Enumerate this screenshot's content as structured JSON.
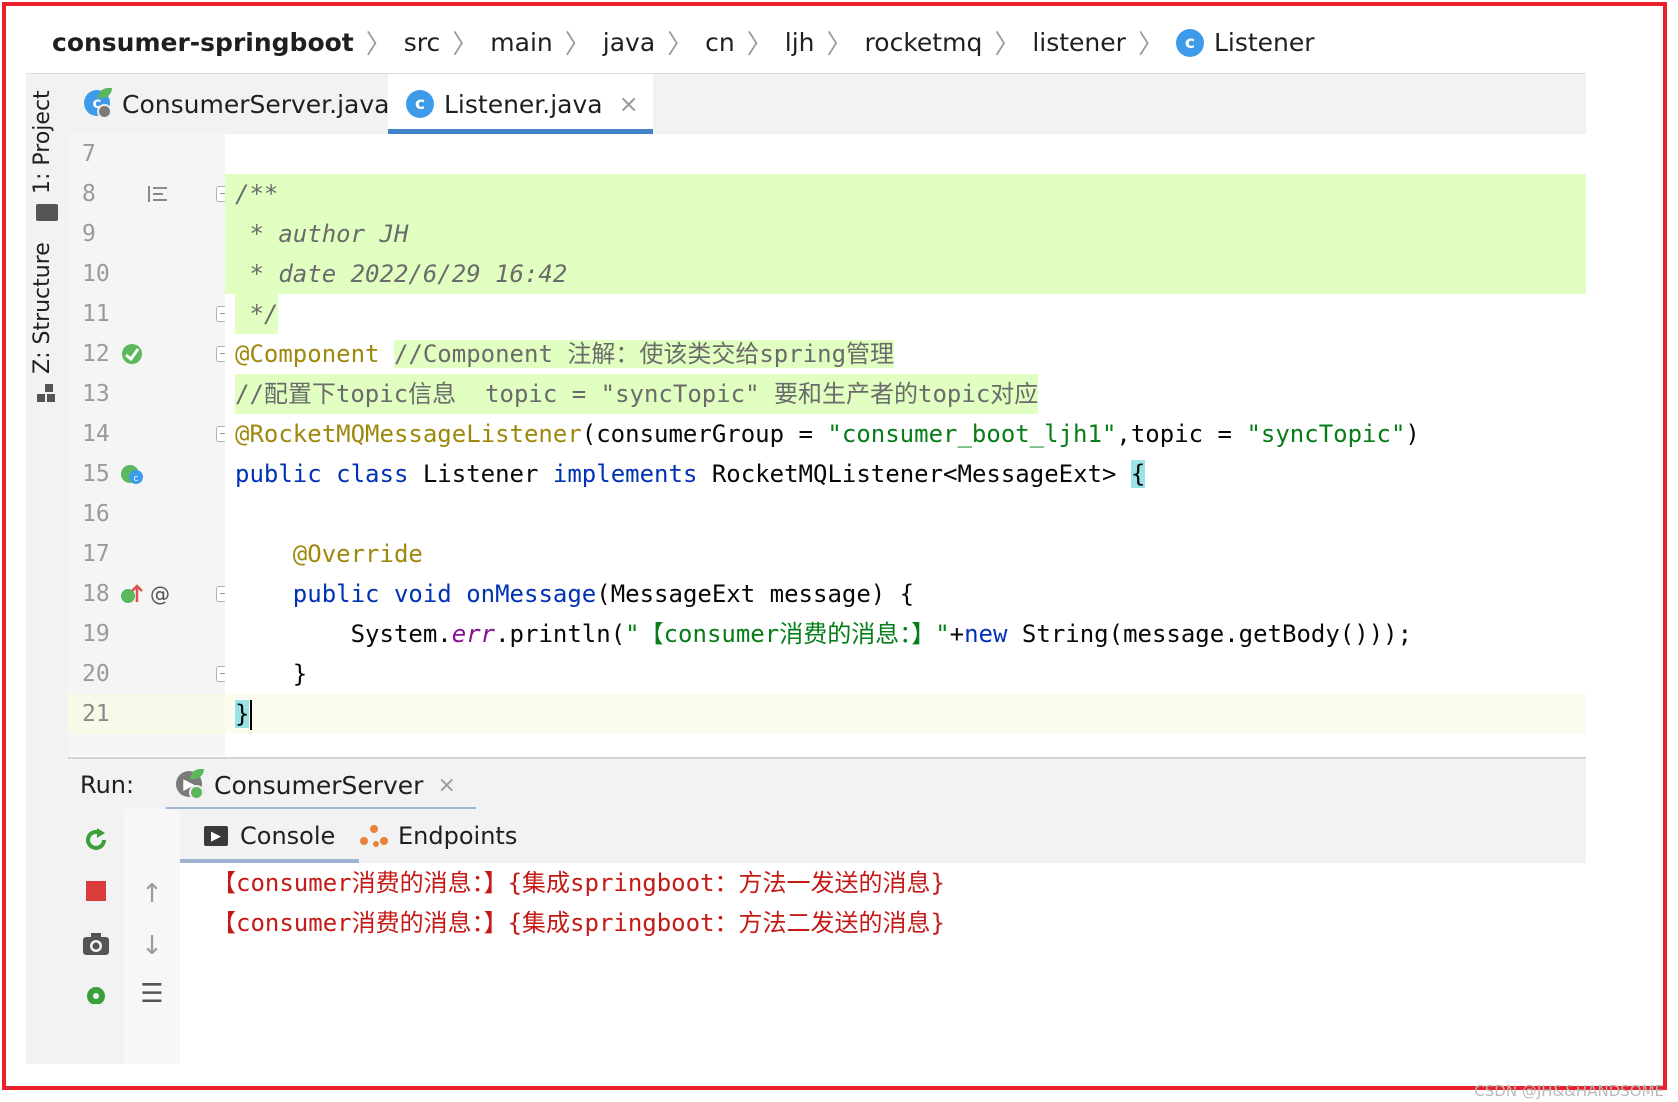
{
  "breadcrumb": {
    "items": [
      "consumer-springboot",
      "src",
      "main",
      "java",
      "cn",
      "ljh",
      "rocketmq",
      "listener",
      "Listener"
    ],
    "class_icon_letter": "c"
  },
  "left_strip": {
    "project_tab": "1: Project",
    "structure_tab": "Z: Structure"
  },
  "editor_tabs": [
    {
      "label": "ConsumerServer.java",
      "close": "×",
      "icon": "spring-boot-class-icon"
    },
    {
      "label": "Listener.java",
      "close": "×",
      "icon": "class-icon",
      "icon_letter": "c",
      "active": true
    }
  ],
  "code": {
    "line_numbers": [
      "7",
      "8",
      "9",
      "10",
      "11",
      "12",
      "13",
      "14",
      "15",
      "16",
      "17",
      "18",
      "19",
      "20",
      "21"
    ],
    "line8": "/**",
    "line9": " * author JH",
    "line10": " * date 2022/6/29 16:42",
    "line11": " */",
    "line12_annot": "@Component",
    "line12_comment": "//Component 注解：使该类交给spring管理",
    "line13_comment": "//配置下topic信息  topic = \"syncTopic\" 要和生产者的topic对应",
    "line14_annot": "@RocketMQMessageListener",
    "line14_p1": "(consumerGroup = ",
    "line14_s1": "\"consumer_boot_ljh1\"",
    "line14_p2": ",topic = ",
    "line14_s2": "\"syncTopic\"",
    "line14_p3": ")",
    "line15_kw1": "public",
    "line15_kw2": "class",
    "line15_name": "Listener",
    "line15_kw3": "implements",
    "line15_type": "RocketMQListener<MessageExt>",
    "line15_brace": "{",
    "line17_annot": "@Override",
    "line18_kw1": "public",
    "line18_kw2": "void",
    "line18_method": "onMessage",
    "line18_rest": "(MessageExt message) {",
    "line19_p1": "System.",
    "line19_field": "err",
    "line19_p2": ".println(",
    "line19_str": "\"【consumer消费的消息：】\"",
    "line19_p3": "+",
    "line19_kw": "new",
    "line19_p4": " String(message.getBody()));",
    "line20": "}",
    "line21": "}"
  },
  "run_panel": {
    "label": "Run:",
    "tab": "ConsumerServer",
    "close": "×",
    "console_tab": "Console",
    "console_icon_glyph": "▶",
    "endpoints_tab": "Endpoints",
    "output": [
      "【consumer消费的消息：】{集成springboot：方法一发送的消息}",
      "【consumer消费的消息：】{集成springboot：方法二发送的消息}"
    ]
  },
  "watermark": "CSDN @JH&&HANDSOME",
  "colors": {
    "frame_border": "#e8212a",
    "doc_highlight": "#e1ffc0",
    "keyword": "#0033b3",
    "string": "#067d17",
    "annotation": "#9e880d",
    "console_error": "#c41a16",
    "class_icon": "#3d9be9"
  }
}
